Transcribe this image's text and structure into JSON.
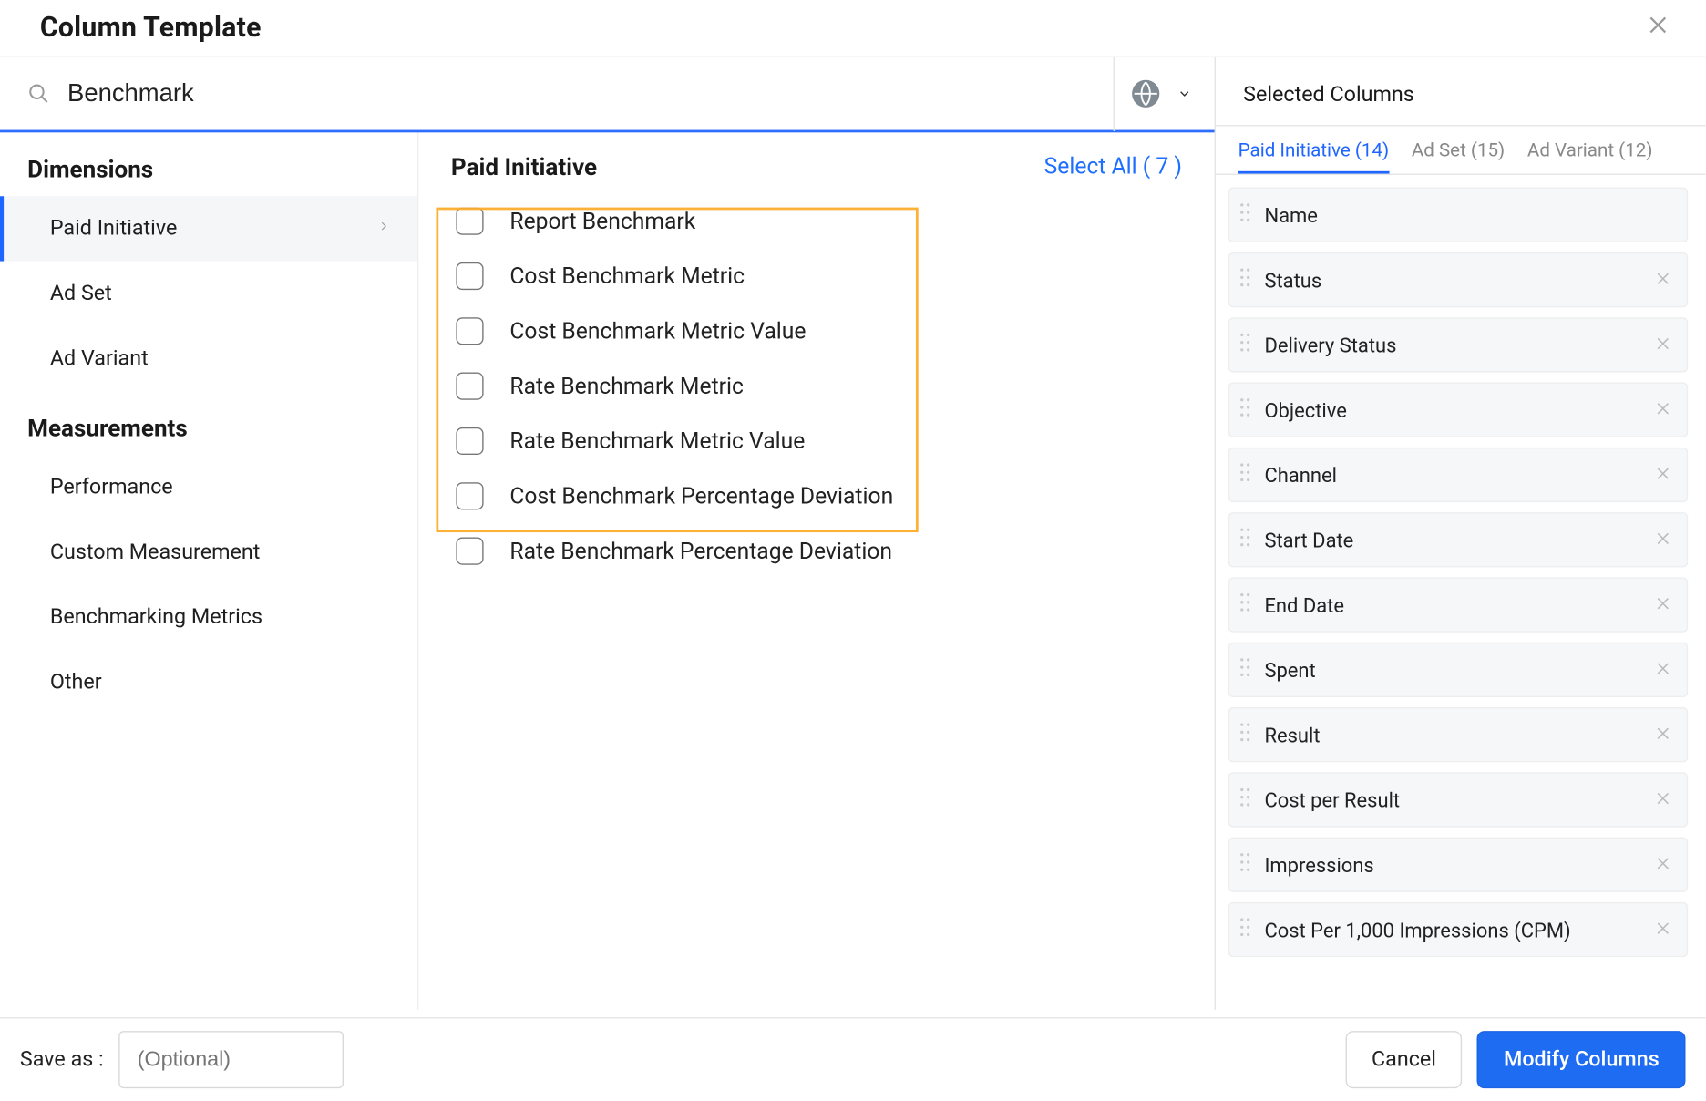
{
  "header": {
    "title": "Column Template"
  },
  "search": {
    "value": "Benchmark",
    "placeholder": ""
  },
  "left": {
    "group1_title": "Dimensions",
    "group1_items": [
      {
        "label": "Paid Initiative",
        "active": true
      },
      {
        "label": "Ad Set",
        "active": false
      },
      {
        "label": "Ad Variant",
        "active": false
      }
    ],
    "group2_title": "Measurements",
    "group2_items": [
      {
        "label": "Performance"
      },
      {
        "label": "Custom Measurement"
      },
      {
        "label": "Benchmarking Metrics"
      },
      {
        "label": "Other"
      }
    ]
  },
  "mid": {
    "title": "Paid Initiative",
    "select_all_label": "Select All ( 7 )",
    "options": [
      {
        "label": "Report Benchmark",
        "checked": false
      },
      {
        "label": "Cost Benchmark Metric",
        "checked": false
      },
      {
        "label": "Cost Benchmark Metric Value",
        "checked": false
      },
      {
        "label": "Rate Benchmark Metric",
        "checked": false
      },
      {
        "label": "Rate Benchmark Metric Value",
        "checked": false
      },
      {
        "label": "Cost Benchmark Percentage Deviation",
        "checked": false
      },
      {
        "label": "Rate Benchmark Percentage Deviation",
        "checked": false
      }
    ]
  },
  "right": {
    "header": "Selected Columns",
    "tabs": [
      {
        "label": "Paid Initiative (14)",
        "active": true
      },
      {
        "label": "Ad Set (15)",
        "active": false
      },
      {
        "label": "Ad Variant (12)",
        "active": false
      }
    ],
    "selected": [
      {
        "label": "Name",
        "removable": false
      },
      {
        "label": "Status",
        "removable": true
      },
      {
        "label": "Delivery Status",
        "removable": true
      },
      {
        "label": "Objective",
        "removable": true
      },
      {
        "label": "Channel",
        "removable": true
      },
      {
        "label": "Start Date",
        "removable": true
      },
      {
        "label": "End Date",
        "removable": true
      },
      {
        "label": "Spent",
        "removable": true
      },
      {
        "label": "Result",
        "removable": true
      },
      {
        "label": "Cost per Result",
        "removable": true
      },
      {
        "label": "Impressions",
        "removable": true
      },
      {
        "label": "Cost Per 1,000 Impressions (CPM)",
        "removable": true
      }
    ]
  },
  "footer": {
    "save_label": "Save as :",
    "save_placeholder": "(Optional)",
    "cancel_label": "Cancel",
    "primary_label": "Modify Columns"
  }
}
